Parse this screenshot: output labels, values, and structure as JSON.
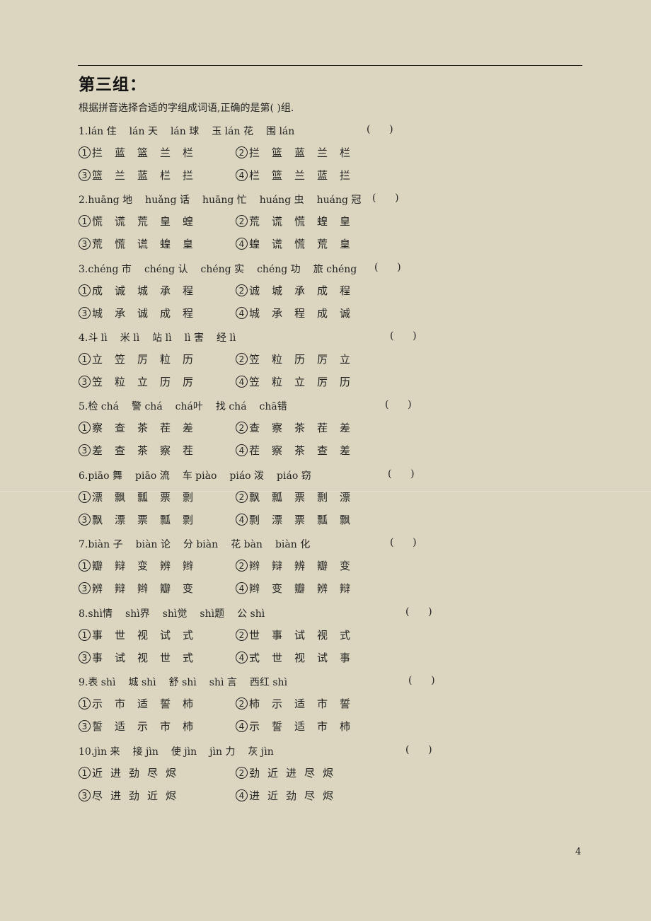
{
  "section_title": "第三组：",
  "instructions": "根据拼音选择合适的字组成词语,正确的是第(        )组.",
  "answer_paren": "(      )",
  "page_number": "4",
  "questions": [
    {
      "number": "1.",
      "prompt": [
        "lán 住",
        "lán 天",
        "lán 球",
        "玉 lán 花",
        "围 lán"
      ],
      "options": [
        {
          "label": "①",
          "chars": [
            "拦",
            "蓝",
            "篮",
            "兰",
            "栏"
          ]
        },
        {
          "label": "②",
          "chars": [
            "拦",
            "篮",
            "蓝",
            "兰",
            "栏"
          ]
        },
        {
          "label": "③",
          "chars": [
            "篮",
            "兰",
            "蓝",
            "栏",
            "拦"
          ]
        },
        {
          "label": "④",
          "chars": [
            "栏",
            "篮",
            "兰",
            "蓝",
            "拦"
          ]
        }
      ]
    },
    {
      "number": "2.",
      "prompt": [
        "huāng 地",
        "huǎng 话",
        "huāng 忙",
        "huáng 虫",
        "huáng 冠"
      ],
      "options": [
        {
          "label": "①",
          "chars": [
            "慌",
            "谎",
            "荒",
            "皇",
            "蝗"
          ]
        },
        {
          "label": "②",
          "chars": [
            "荒",
            "谎",
            "慌",
            "蝗",
            "皇"
          ]
        },
        {
          "label": "③",
          "chars": [
            "荒",
            "慌",
            "谎",
            "蝗",
            "皇"
          ]
        },
        {
          "label": "④",
          "chars": [
            "蝗",
            "谎",
            "慌",
            "荒",
            "皇"
          ]
        }
      ]
    },
    {
      "number": "3.",
      "prompt": [
        "chéng 市",
        "chéng 认",
        "chéng 实",
        "chéng 功",
        "旅 chéng"
      ],
      "options": [
        {
          "label": "①",
          "chars": [
            "成",
            "诚",
            "城",
            "承",
            "程"
          ]
        },
        {
          "label": "②",
          "chars": [
            "诚",
            "城",
            "承",
            "成",
            "程"
          ]
        },
        {
          "label": "③",
          "chars": [
            "城",
            "承",
            "诚",
            "成",
            "程"
          ]
        },
        {
          "label": "④",
          "chars": [
            "城",
            "承",
            "程",
            "成",
            "诚"
          ]
        }
      ]
    },
    {
      "number": "4.",
      "prompt": [
        "斗 lì",
        "米 lì",
        "站 lì",
        "lì 害",
        "经 lì"
      ],
      "options": [
        {
          "label": "①",
          "chars": [
            "立",
            "笠",
            "厉",
            "粒",
            "历"
          ]
        },
        {
          "label": "②",
          "chars": [
            "笠",
            "粒",
            "历",
            "厉",
            "立"
          ]
        },
        {
          "label": "③",
          "chars": [
            "笠",
            "粒",
            "立",
            "历",
            "厉"
          ]
        },
        {
          "label": "④",
          "chars": [
            "笠",
            "粒",
            "立",
            "厉",
            "历"
          ]
        }
      ]
    },
    {
      "number": "5.",
      "prompt": [
        "检 chá",
        "警 chá",
        "chá叶",
        "找 chá",
        "chā错"
      ],
      "options": [
        {
          "label": "①",
          "chars": [
            "察",
            "查",
            "茶",
            "茬",
            "差"
          ]
        },
        {
          "label": "②",
          "chars": [
            "查",
            "察",
            "茶",
            "茬",
            "差"
          ]
        },
        {
          "label": "③",
          "chars": [
            "差",
            "查",
            "茶",
            "察",
            "茬"
          ]
        },
        {
          "label": "④",
          "chars": [
            "茬",
            "察",
            "茶",
            "查",
            "差"
          ]
        }
      ]
    },
    {
      "number": "6.",
      "prompt": [
        "piāo 舞",
        "piāo 流",
        "车 piào",
        "piáo 泼",
        "piáo 窃"
      ],
      "options": [
        {
          "label": "①",
          "chars": [
            "漂",
            "飘",
            "瓢",
            "票",
            "剽"
          ]
        },
        {
          "label": "②",
          "chars": [
            "飘",
            "瓢",
            "票",
            "剽",
            "漂"
          ]
        },
        {
          "label": "③",
          "chars": [
            "飘",
            "漂",
            "票",
            "瓢",
            "剽"
          ]
        },
        {
          "label": "④",
          "chars": [
            "剽",
            "漂",
            "票",
            "瓢",
            "飘"
          ]
        }
      ]
    },
    {
      "number": "7.",
      "prompt": [
        "biàn 子",
        "biàn 论",
        "分 biàn",
        "花 bàn",
        "biàn 化"
      ],
      "options": [
        {
          "label": "①",
          "chars": [
            "瓣",
            "辩",
            "变",
            "辨",
            "辫"
          ]
        },
        {
          "label": "②",
          "chars": [
            "辫",
            "辩",
            "辨",
            "瓣",
            "变"
          ]
        },
        {
          "label": "③",
          "chars": [
            "辨",
            "辩",
            "辫",
            "瓣",
            "变"
          ]
        },
        {
          "label": "④",
          "chars": [
            "辫",
            "变",
            "瓣",
            "辨",
            "辩"
          ]
        }
      ]
    },
    {
      "number": "8.",
      "prompt": [
        "shì情",
        "shì界",
        "shì觉",
        "shì题",
        "公 shì"
      ],
      "options": [
        {
          "label": "①",
          "chars": [
            "事",
            "世",
            "视",
            "试",
            "式"
          ]
        },
        {
          "label": "②",
          "chars": [
            "世",
            "事",
            "试",
            "视",
            "式"
          ]
        },
        {
          "label": "③",
          "chars": [
            "事",
            "试",
            "视",
            "世",
            "式"
          ]
        },
        {
          "label": "④",
          "chars": [
            "式",
            "世",
            "视",
            "试",
            "事"
          ]
        }
      ]
    },
    {
      "number": "9.",
      "prompt": [
        "表 shì",
        "城 shì",
        "舒 shì",
        "shì 言",
        "西红 shì"
      ],
      "options": [
        {
          "label": "①",
          "chars": [
            "示",
            "市",
            "适",
            "誓",
            "柿"
          ]
        },
        {
          "label": "②",
          "chars": [
            "柿",
            "示",
            "适",
            "市",
            "誓"
          ]
        },
        {
          "label": "③",
          "chars": [
            "誓",
            "适",
            "示",
            "市",
            "柿"
          ]
        },
        {
          "label": "④",
          "chars": [
            "示",
            "誓",
            "适",
            "市",
            "柿"
          ]
        }
      ]
    },
    {
      "number": "10.",
      "prompt": [
        "jìn 来",
        "接 jìn",
        "使 jìn",
        "jìn 力",
        "灰 jìn"
      ],
      "options": [
        {
          "label": "①",
          "chars": [
            "近",
            "进",
            "劲",
            "尽",
            "烬"
          ]
        },
        {
          "label": "②",
          "chars": [
            "劲",
            "近",
            "进",
            "尽",
            "烬"
          ]
        },
        {
          "label": "③",
          "chars": [
            "尽",
            "进",
            "劲",
            "近",
            "烬"
          ]
        },
        {
          "label": "④",
          "chars": [
            "进",
            "近",
            "劲",
            "尽",
            "烬"
          ]
        }
      ]
    }
  ]
}
